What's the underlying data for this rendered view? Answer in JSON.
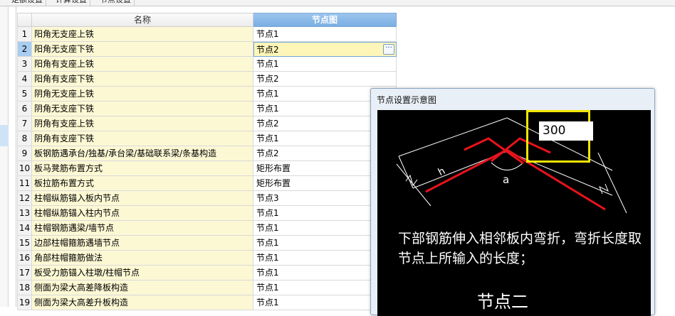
{
  "top_tabs": [
    "定额设置",
    "计算设置",
    "节点设置"
  ],
  "grid": {
    "col_name": "名称",
    "col_node": "节点图",
    "rows": [
      {
        "num": "1",
        "name": "阳角无支座上铁",
        "node": "节点1"
      },
      {
        "num": "2",
        "name": "阳角无支座下铁",
        "node": "节点2",
        "active": true
      },
      {
        "num": "3",
        "name": "阳角有支座上铁",
        "node": "节点1"
      },
      {
        "num": "4",
        "name": "阳角有支座下铁",
        "node": "节点2"
      },
      {
        "num": "5",
        "name": "阴角无支座上铁",
        "node": "节点1"
      },
      {
        "num": "6",
        "name": "阴角无支座下铁",
        "node": "节点1"
      },
      {
        "num": "7",
        "name": "阴角有支座上铁",
        "node": "节点2"
      },
      {
        "num": "8",
        "name": "阴角有支座下铁",
        "node": "节点1"
      },
      {
        "num": "9",
        "name": "板钢筋遇承台/独基/承台梁/基础联系梁/条基构造",
        "node": "节点2"
      },
      {
        "num": "10",
        "name": "板马凳筋布置方式",
        "node": "矩形布置"
      },
      {
        "num": "11",
        "name": "板拉筋布置方式",
        "node": "矩形布置"
      },
      {
        "num": "12",
        "name": "柱帽纵筋锚入板内节点",
        "node": "节点3"
      },
      {
        "num": "13",
        "name": "柱帽纵筋锚入柱内节点",
        "node": "节点1"
      },
      {
        "num": "14",
        "name": "柱帽钢筋遇梁/墙节点",
        "node": "节点1"
      },
      {
        "num": "15",
        "name": "边部柱帽箍筋遇墙节点",
        "node": "节点1"
      },
      {
        "num": "16",
        "name": "角部柱帽箍筋做法",
        "node": "节点1"
      },
      {
        "num": "17",
        "name": "板受力筋锚入柱墩/柱帽节点",
        "node": "节点1"
      },
      {
        "num": "18",
        "name": "侧面为梁大高差降板构造",
        "node": "节点1"
      },
      {
        "num": "19",
        "name": "侧面为梁大高差升板构造",
        "node": "节点1"
      }
    ],
    "ellipsis_label": "···"
  },
  "preview": {
    "title": "节点设置示意图",
    "input_value": "300",
    "angle_label": "a",
    "h_label": "h",
    "description": "下部钢筋伸入相邻板内弯折，弯折长度取节点上所输入的长度；",
    "caption": "节点二"
  },
  "colors": {
    "accent_header": "#7aaee2",
    "name_cell_bg": "#fcf8d4",
    "rebar_red": "#e8131b",
    "highlight_yellow": "#f2e600"
  }
}
